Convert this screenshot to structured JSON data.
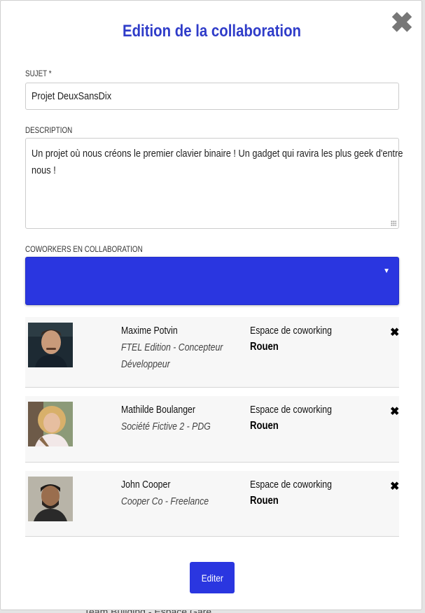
{
  "background": {
    "footer_fragment": "Team Building - Espace Gare"
  },
  "modal": {
    "title": "Edition de la collaboration",
    "close_icon": "close-x-icon"
  },
  "form": {
    "subject_label": "SUJET",
    "subject_required_mark": "*",
    "subject_value": "Projet DeuxSansDix",
    "description_label": "DESCRIPTION",
    "description_lines": [
      "Un projet où nous créons le premier clavier binaire ! Un gadget qui ravira  les plus geek d'entre",
      "nous !"
    ],
    "coworkers_label": "COWORKERS EN COLLABORATION",
    "coworkers_select_value": "",
    "select_color": "#2a36e0"
  },
  "coworkers": [
    {
      "name": "Maxime Potvin",
      "company_lines": [
        "FTEL Edition - Concepteur",
        "Développeur"
      ],
      "space_label": "Espace de coworking",
      "city": "Rouen",
      "remove_icon": "remove-x-icon"
    },
    {
      "name": "Mathilde Boulanger",
      "company_lines": [
        "Société Fictive 2 - PDG"
      ],
      "space_label": "Espace de coworking",
      "city": "Rouen",
      "remove_icon": "remove-x-icon"
    },
    {
      "name": "John Cooper",
      "company_lines": [
        "Cooper Co - Freelance"
      ],
      "space_label": "Espace de coworking",
      "city": "Rouen",
      "remove_icon": "remove-x-icon"
    }
  ],
  "actions": {
    "submit_label": "Editer"
  }
}
